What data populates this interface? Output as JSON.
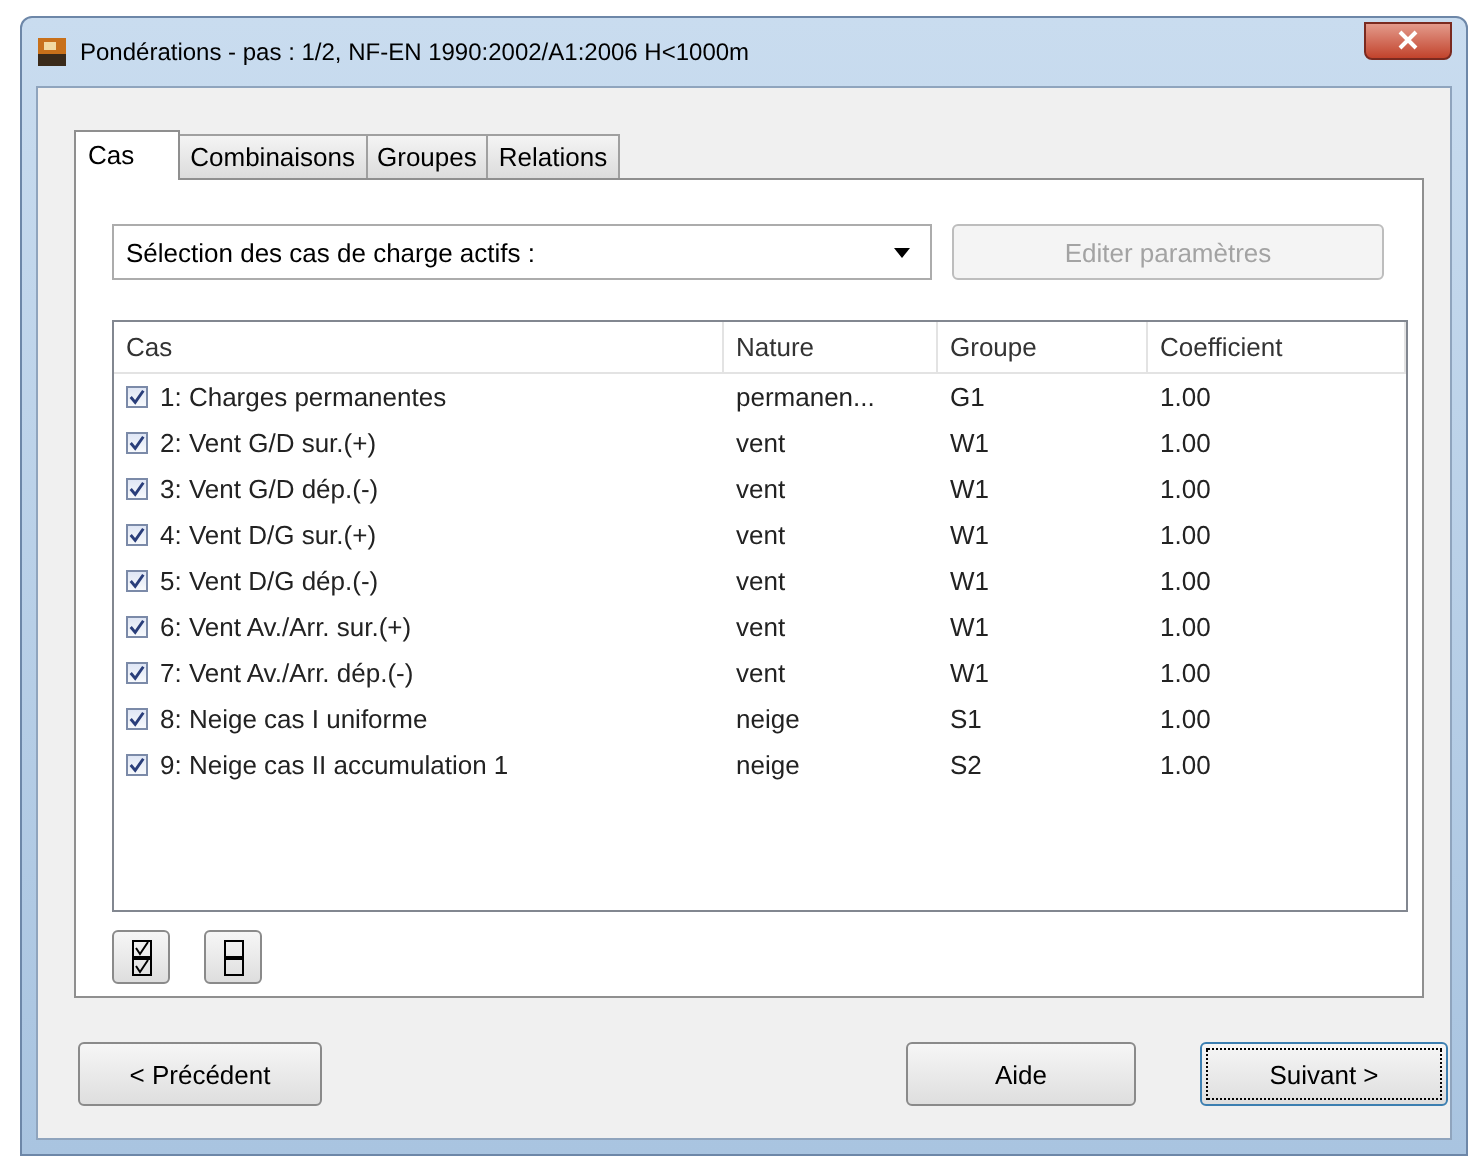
{
  "window": {
    "title": "Pondérations - pas : 1/2, NF-EN 1990:2002/A1:2006 H<1000m"
  },
  "tabs": [
    {
      "label": "Cas",
      "selected": true
    },
    {
      "label": "Combinaisons",
      "selected": false
    },
    {
      "label": "Groupes",
      "selected": false
    },
    {
      "label": "Relations",
      "selected": false
    }
  ],
  "selector": {
    "value": "Sélection des cas de charge actifs :"
  },
  "edit_button": {
    "label": "Editer paramètres",
    "disabled": true
  },
  "table": {
    "columns": [
      "Cas",
      "Nature",
      "Groupe",
      "Coefficient"
    ],
    "rows": [
      {
        "checked": true,
        "cells": [
          "1: Charges permanentes",
          "permanen...",
          "G1",
          "1.00"
        ]
      },
      {
        "checked": true,
        "cells": [
          "2: Vent G/D sur.(+)",
          "vent",
          "W1",
          "1.00"
        ]
      },
      {
        "checked": true,
        "cells": [
          "3: Vent G/D dép.(-)",
          "vent",
          "W1",
          "1.00"
        ]
      },
      {
        "checked": true,
        "cells": [
          "4: Vent D/G sur.(+)",
          "vent",
          "W1",
          "1.00"
        ]
      },
      {
        "checked": true,
        "cells": [
          "5: Vent D/G dép.(-)",
          "vent",
          "W1",
          "1.00"
        ]
      },
      {
        "checked": true,
        "cells": [
          "6: Vent Av./Arr. sur.(+)",
          "vent",
          "W1",
          "1.00"
        ]
      },
      {
        "checked": true,
        "cells": [
          "7: Vent Av./Arr. dép.(-)",
          "vent",
          "W1",
          "1.00"
        ]
      },
      {
        "checked": true,
        "cells": [
          "8: Neige cas I uniforme",
          "neige",
          "S1",
          "1.00"
        ]
      },
      {
        "checked": true,
        "cells": [
          "9: Neige cas II accumulation 1",
          "neige",
          "S2",
          "1.00"
        ]
      }
    ]
  },
  "footer_buttons": [
    {
      "label": "< Précédent",
      "focused": false
    },
    {
      "label": "Aide",
      "focused": false
    },
    {
      "label": "Suivant >",
      "focused": true
    }
  ]
}
